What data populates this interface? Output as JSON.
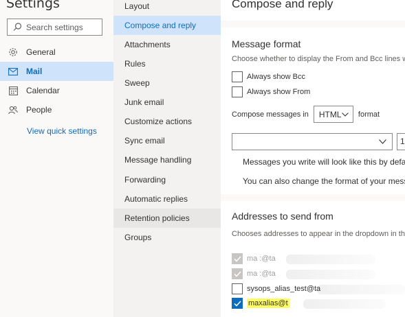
{
  "settings": {
    "title": "Settings",
    "search_placeholder": "Search settings"
  },
  "nav": {
    "items": [
      {
        "label": "General",
        "icon": "gear-icon"
      },
      {
        "label": "Mail",
        "icon": "mail-icon"
      },
      {
        "label": "Calendar",
        "icon": "calendar-icon"
      },
      {
        "label": "People",
        "icon": "people-icon"
      }
    ],
    "quick_settings_link": "View quick settings"
  },
  "submenu": {
    "items": [
      "Layout",
      "Compose and reply",
      "Attachments",
      "Rules",
      "Sweep",
      "Junk email",
      "Customize actions",
      "Sync email",
      "Message handling",
      "Forwarding",
      "Automatic replies",
      "Retention policies",
      "Groups"
    ]
  },
  "content": {
    "page_title": "Compose and reply",
    "message_format": {
      "title": "Message format",
      "description": "Choose whether to display the From and Bcc lines wh",
      "always_bcc": "Always show Bcc",
      "always_from": "Always show From",
      "compose_prefix": "Compose messages in",
      "compose_format": "HTML",
      "compose_suffix": "format",
      "size_value": "1",
      "preview_line1": "Messages you write will look like this by defaul",
      "preview_line2": "You can also change the format of your messag"
    },
    "addresses": {
      "title": "Addresses to send from",
      "description": "Chooses addresses to appear in the dropdown in the",
      "items": [
        {
          "label": "ma      :@ta",
          "state": "dim-checked"
        },
        {
          "label": "ma      :@ta",
          "state": "dim-checked"
        },
        {
          "label": "sysops_alias_test@ta",
          "state": "unchecked"
        },
        {
          "label": "maxalias@t",
          "state": "checked"
        }
      ]
    }
  },
  "colors": {
    "accent": "#0f6cbd",
    "active_bg": "#cfe4fa",
    "highlight": "#fffb63"
  }
}
